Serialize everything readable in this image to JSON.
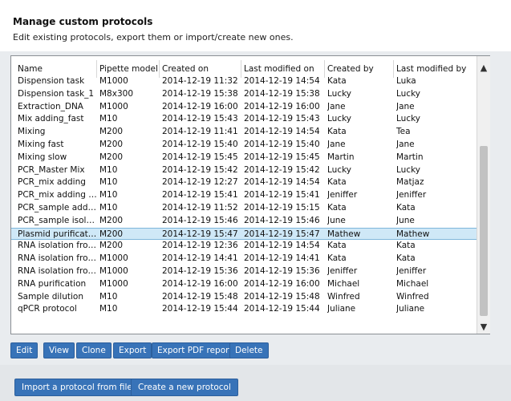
{
  "header": {
    "title": "Manage custom protocols",
    "subtitle": "Edit existing protocols, export them or import/create new ones."
  },
  "table": {
    "columns": [
      "Name",
      "Pipette model",
      "Created on",
      "Last modified on",
      "Created by",
      "Last modified by"
    ],
    "rows": [
      [
        "Dispension task",
        "M1000",
        "2014-12-19 11:32",
        "2014-12-19 14:54",
        "Kata",
        "Luka"
      ],
      [
        "Dispension task_1",
        "M8x300",
        "2014-12-19 15:38",
        "2014-12-19 15:38",
        "Lucky",
        "Lucky"
      ],
      [
        "Extraction_DNA",
        "M1000",
        "2014-12-19 16:00",
        "2014-12-19 16:00",
        "Jane",
        "Jane"
      ],
      [
        "Mix adding_fast",
        "M10",
        "2014-12-19 15:43",
        "2014-12-19 15:43",
        "Lucky",
        "Lucky"
      ],
      [
        "Mixing",
        "M200",
        "2014-12-19 11:41",
        "2014-12-19 14:54",
        "Kata",
        "Tea"
      ],
      [
        "Mixing fast",
        "M200",
        "2014-12-19 15:40",
        "2014-12-19 15:40",
        "Jane",
        "Jane"
      ],
      [
        "Mixing slow",
        "M200",
        "2014-12-19 15:45",
        "2014-12-19 15:45",
        "Martin",
        "Martin"
      ],
      [
        "PCR_Master Mix",
        "M10",
        "2014-12-19 15:42",
        "2014-12-19 15:42",
        "Lucky",
        "Lucky"
      ],
      [
        "PCR_mix adding",
        "M10",
        "2014-12-19 12:27",
        "2014-12-19 14:54",
        "Kata",
        "Matjaz"
      ],
      [
        "PCR_mix adding sl...",
        "M10",
        "2014-12-19 15:41",
        "2014-12-19 15:41",
        "Jeniffer",
        "Jeniffer"
      ],
      [
        "PCR_sample adding",
        "M10",
        "2014-12-19 11:52",
        "2014-12-19 15:15",
        "Kata",
        "Kata"
      ],
      [
        "PCR_sample isolati...",
        "M200",
        "2014-12-19 15:46",
        "2014-12-19 15:46",
        "June",
        "June"
      ],
      [
        "Plasmid purification",
        "M200",
        "2014-12-19 15:47",
        "2014-12-19 15:47",
        "Mathew",
        "Mathew"
      ],
      [
        "RNA isolation from...",
        "M200",
        "2014-12-19 12:36",
        "2014-12-19 14:54",
        "Kata",
        "Kata"
      ],
      [
        "RNA isolation from...",
        "M1000",
        "2014-12-19 14:41",
        "2014-12-19 14:41",
        "Kata",
        "Kata"
      ],
      [
        "RNA isolation from...",
        "M1000",
        "2014-12-19 15:36",
        "2014-12-19 15:36",
        "Jeniffer",
        "Jeniffer"
      ],
      [
        "RNA purification",
        "M1000",
        "2014-12-19 16:00",
        "2014-12-19 16:00",
        "Michael",
        "Michael"
      ],
      [
        "Sample dilution",
        "M10",
        "2014-12-19 15:48",
        "2014-12-19 15:48",
        "Winfred",
        "Winfred"
      ],
      [
        "qPCR protocol",
        "M10",
        "2014-12-19 15:44",
        "2014-12-19 15:44",
        "Juliane",
        "Juliane"
      ]
    ],
    "selected_row_index": 12
  },
  "scrollbar": {
    "up_icon": "chevron-up-icon",
    "down_icon": "chevron-down-icon"
  },
  "actions": {
    "edit": "Edit",
    "view": "View",
    "clone": "Clone",
    "export": "Export",
    "export_pdf": "Export PDF report",
    "delete": "Delete"
  },
  "bottom_actions": {
    "import": "Import a protocol from file",
    "create": "Create a new protocol"
  },
  "colors": {
    "accent": "#3873b8",
    "selection": "#cfe8f7",
    "background": "#e9ecef"
  }
}
